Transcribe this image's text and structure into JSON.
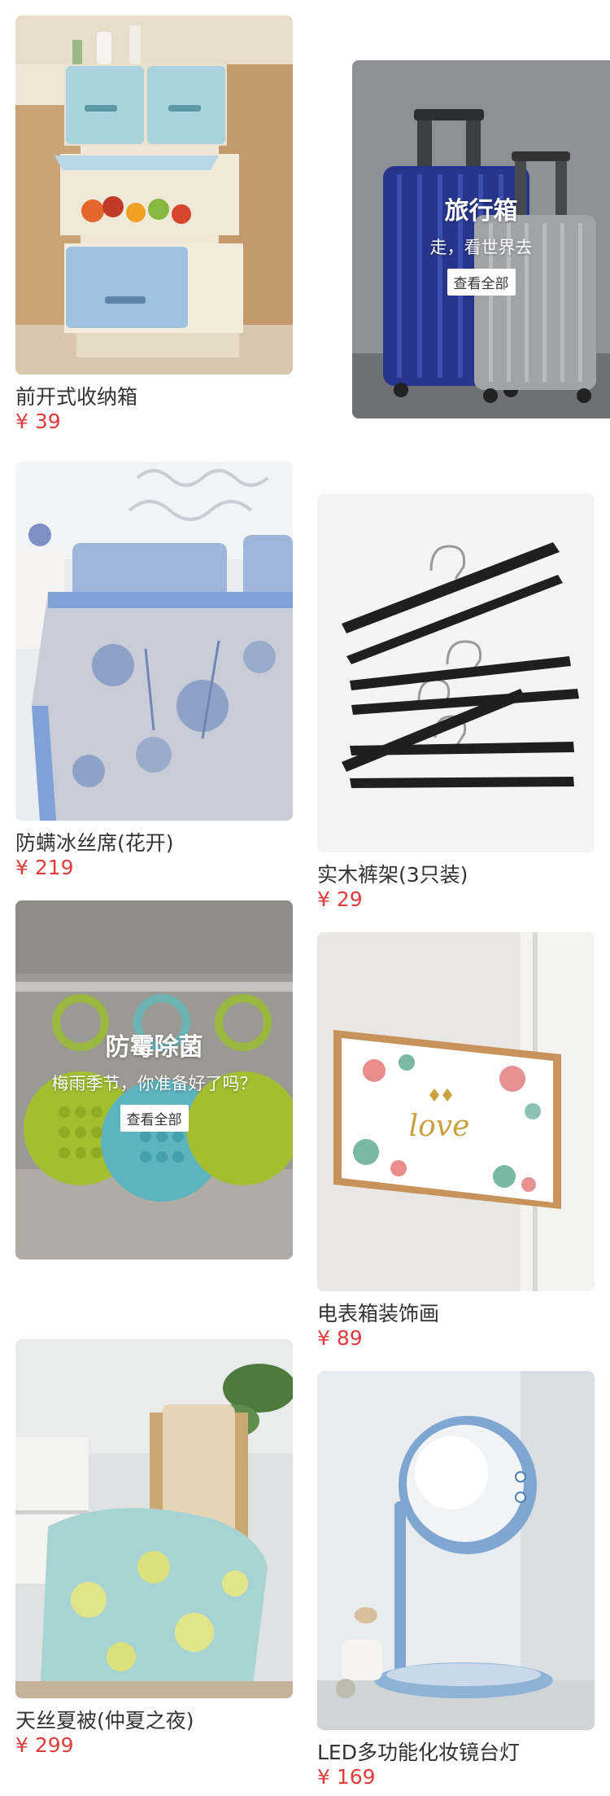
{
  "products": [
    {
      "title": "前开式收纳箱",
      "price": "¥ 39",
      "image_alt": "storage-boxes"
    },
    {
      "title": "防螨冰丝席(花开)",
      "price": "¥ 219",
      "image_alt": "ice-silk-mat"
    },
    {
      "title": "实木裤架(3只装)",
      "price": "¥ 29",
      "image_alt": "pants-hangers"
    },
    {
      "title": "电表箱装饰画",
      "price": "¥ 89",
      "image_alt": "meter-box-painting"
    },
    {
      "title": "天丝夏被(仲夏之夜)",
      "price": "¥ 299",
      "image_alt": "summer-quilt"
    },
    {
      "title": "LED多功能化妆镜台灯",
      "price": "¥ 169",
      "image_alt": "led-mirror-lamp"
    }
  ],
  "promos": [
    {
      "title": "旅行箱",
      "subtitle": "走，看世界去",
      "button": "查看全部"
    },
    {
      "title": "防霉除菌",
      "subtitle": "梅雨季节，你准备好了吗？",
      "button": "查看全部"
    }
  ],
  "colors": {
    "price": "#e03c3c",
    "text": "#333333",
    "background": "#ffffff"
  }
}
